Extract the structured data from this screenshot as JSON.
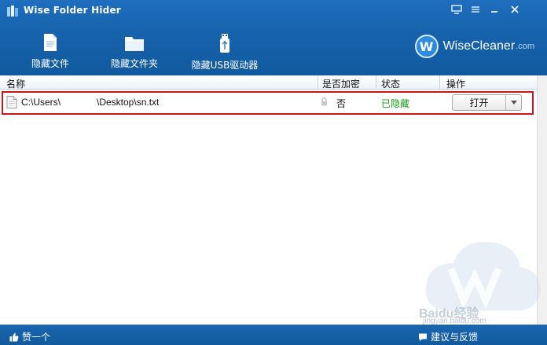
{
  "window": {
    "title": "Wise Folder Hider",
    "controls": {
      "skin": "skin-icon",
      "menu": "menu-icon",
      "minimize": "minimize-icon",
      "close": "close-icon"
    }
  },
  "toolbar": {
    "hide_file": "隐藏文件",
    "hide_folder": "隐藏文件夹",
    "hide_usb": "隐藏USB驱动器"
  },
  "brand": {
    "name": "WiseCleaner",
    "domain": ".com",
    "logo_letter": "W"
  },
  "table": {
    "columns": {
      "name": "名称",
      "encrypted": "是否加密",
      "status": "状态",
      "action": "操作"
    },
    "rows": [
      {
        "path_start": "C:\\Users\\",
        "path_end": "\\Desktop\\sn.txt",
        "encrypted": "否",
        "status": "已隐藏",
        "action_label": "打开"
      }
    ]
  },
  "watermark": {
    "text": "Baidu经验",
    "url": "jingyan.baidu.com"
  },
  "footer": {
    "like": "赞一个",
    "feedback": "建议与反馈"
  },
  "colors": {
    "header": "#1763ad",
    "status_hidden": "#1a9a1a",
    "highlight": "#c8161d"
  }
}
